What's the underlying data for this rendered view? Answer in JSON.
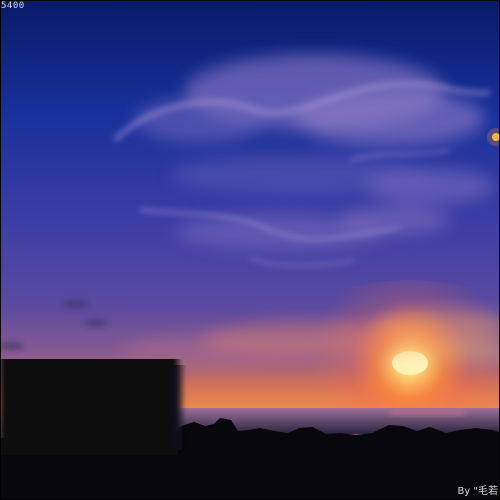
{
  "top_text": "5400",
  "watermark_text": "By \"毛若",
  "colors": {
    "sky_top": "#1a2a8f",
    "sky_mid": "#4b3d9b",
    "horizon_glow": "#ff7a3a",
    "sun_core": "#fff0b0",
    "foreground": "#08070c",
    "text": "#dcdcdc"
  }
}
